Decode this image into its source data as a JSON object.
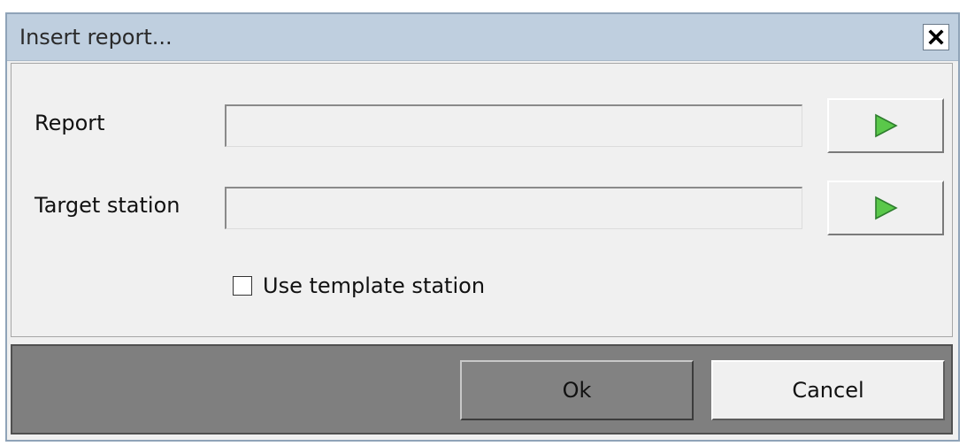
{
  "dialog": {
    "title": "Insert report...",
    "close_icon": "close-icon"
  },
  "fields": {
    "report": {
      "label": "Report",
      "value": "",
      "browse_icon": "play-arrow-icon"
    },
    "target_station": {
      "label": "Target station",
      "value": "",
      "browse_icon": "play-arrow-icon"
    }
  },
  "options": {
    "use_template_station": {
      "label": "Use template station",
      "checked": false
    }
  },
  "footer": {
    "ok_label": "Ok",
    "cancel_label": "Cancel"
  },
  "colors": {
    "titlebar": "#bfcfdf",
    "arrow_fill": "#5ac84a",
    "arrow_stroke": "#2e7d2e",
    "footer": "#7f7f7f"
  }
}
